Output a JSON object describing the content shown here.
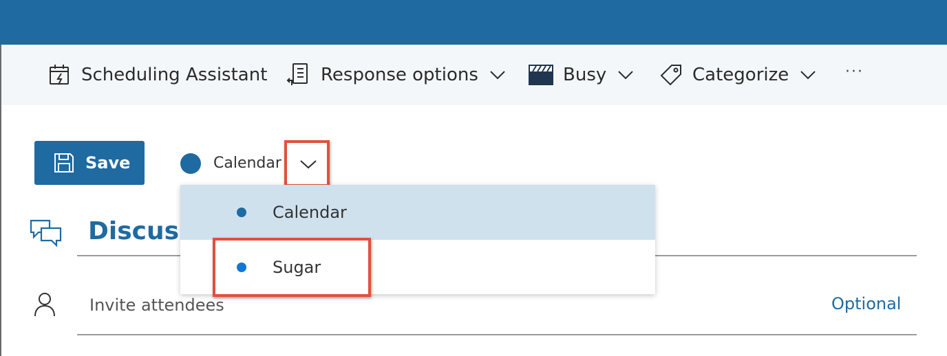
{
  "toolbar": {
    "scheduling_assistant": "Scheduling Assistant",
    "response_options": "Response options",
    "show_as": "Busy",
    "categorize": "Categorize",
    "more": "···"
  },
  "form": {
    "save_label": "Save",
    "calendar_selected": "Calendar",
    "calendar_color": "#1f6aa1",
    "title_partial": "Discuss",
    "invite_placeholder": "Invite attendees",
    "optional_label": "Optional"
  },
  "calendar_dropdown": {
    "options": [
      {
        "label": "Calendar",
        "color": "#1f6aa1",
        "selected": true
      },
      {
        "label": "Sugar",
        "color": "#0f78d4",
        "selected": false
      }
    ]
  },
  "annotations": {
    "highlight_color": "#e0513d"
  },
  "colors": {
    "accent": "#1f6aa1",
    "toolbar_bg": "#f3f7fa"
  }
}
